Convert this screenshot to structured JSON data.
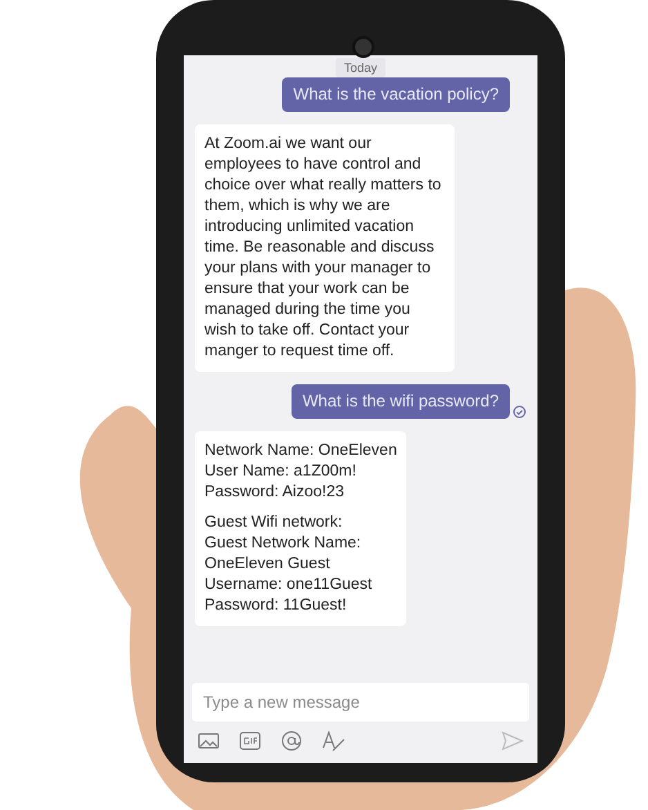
{
  "chat": {
    "date_label": "Today",
    "messages": [
      {
        "kind": "sent",
        "read": false,
        "paragraphs": [
          "What is the vacation policy?"
        ]
      },
      {
        "kind": "received",
        "paragraphs": [
          "At Zoom.ai we want our employees to have control and choice over what really matters to them, which is why we are introducing unlimited vacation time. Be reasonable and discuss your plans with your manager to ensure that your work can be managed during the time you wish to take off. Contact your manger to request time off."
        ]
      },
      {
        "kind": "sent",
        "read": true,
        "paragraphs": [
          "What is the wifi password?"
        ]
      },
      {
        "kind": "received",
        "paragraphs": [
          "Network Name: OneEleven\nUser Name: a1Z00m!\nPassword: Aizoo!23",
          "Guest Wifi network:\nGuest Network Name:\nOneEleven Guest\nUsername: one11Guest\nPassword: 11Guest!"
        ]
      }
    ]
  },
  "composer": {
    "placeholder": "Type a new message"
  }
}
